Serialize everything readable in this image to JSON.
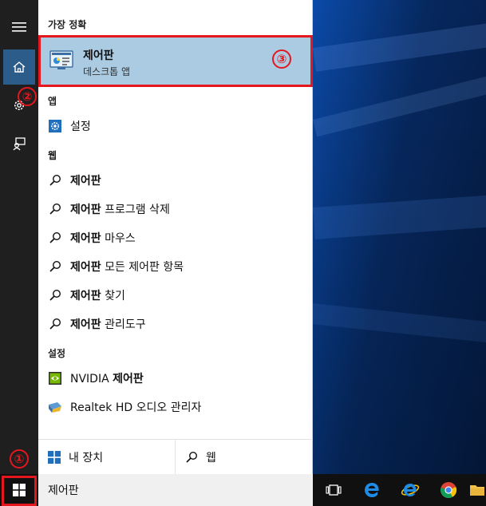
{
  "panel": {
    "header_best_match": "가장 정확",
    "best_match": {
      "title": "제어판",
      "subtitle": "데스크톱 앱"
    },
    "header_apps": "앱",
    "apps": [
      {
        "label": "설정"
      }
    ],
    "header_web": "웹",
    "web": [
      {
        "bold": "제어판",
        "rest": ""
      },
      {
        "bold": "제어판",
        "rest": " 프로그램 삭제"
      },
      {
        "bold": "제어판",
        "rest": " 마우스"
      },
      {
        "bold": "제어판",
        "rest": " 모든 제어판 항목"
      },
      {
        "bold": "제어판",
        "rest": " 찾기"
      },
      {
        "bold": "제어판",
        "rest": " 관리도구"
      }
    ],
    "header_settings": "설정",
    "settings": [
      {
        "pre": "NVIDIA ",
        "bold": "제어판"
      },
      {
        "pre": "Realtek HD 오디오 관리자",
        "bold": ""
      }
    ],
    "bottom": {
      "my_stuff": "내 장치",
      "web": "웹"
    }
  },
  "taskbar": {
    "search_value": "제어판"
  },
  "annotations": {
    "one": "①",
    "two": "②",
    "three": "③"
  },
  "colors": {
    "highlight": "#aacbe1",
    "rail": "#1f1f1f",
    "annotation": "#e4171e",
    "accent": "#2b5c8a"
  },
  "icons": [
    "hamburger-icon",
    "home-icon",
    "gear-icon",
    "feedback-icon",
    "control-panel-icon",
    "settings-gear-icon",
    "search-icon",
    "nvidia-icon",
    "realtek-icon",
    "windows-logo-icon",
    "task-view-icon",
    "edge-icon",
    "ie-icon",
    "chrome-icon",
    "file-explorer-icon"
  ]
}
